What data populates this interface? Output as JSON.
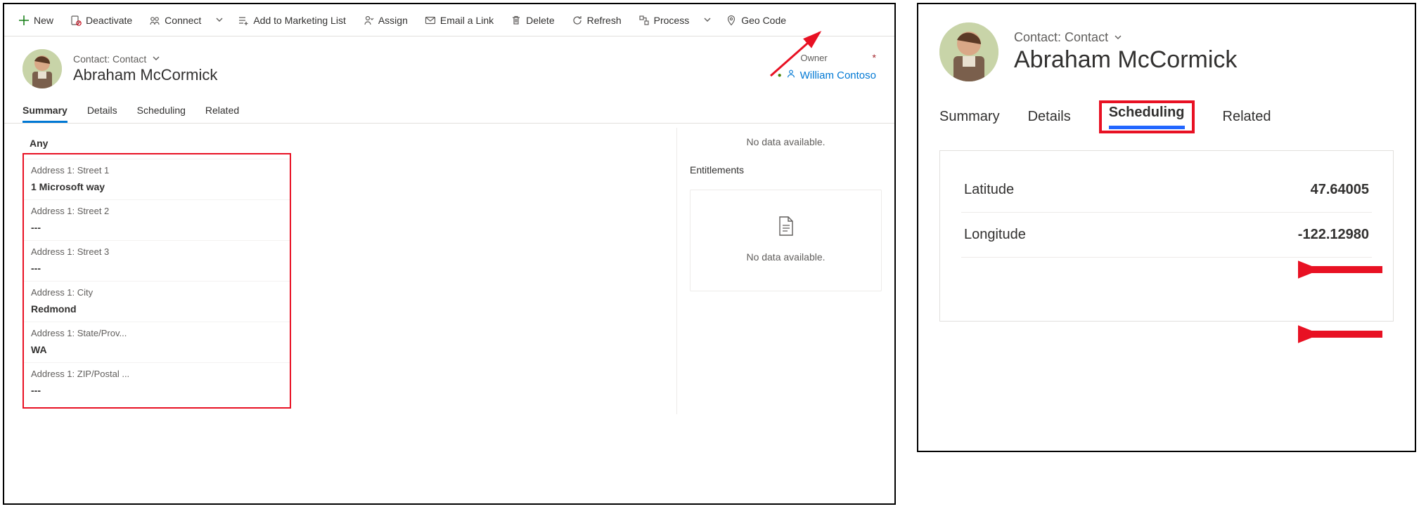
{
  "cmdbar": {
    "new": "New",
    "deactivate": "Deactivate",
    "connect": "Connect",
    "add_marketing": "Add to Marketing List",
    "assign": "Assign",
    "email_link": "Email a Link",
    "delete": "Delete",
    "refresh": "Refresh",
    "process": "Process",
    "geocode": "Geo Code"
  },
  "record": {
    "crumb": "Contact: Contact",
    "name": "Abraham McCormick"
  },
  "owner": {
    "label": "Owner",
    "required": "*",
    "value": "William Contoso"
  },
  "tabs_left": {
    "summary": "Summary",
    "details": "Details",
    "scheduling": "Scheduling",
    "related": "Related"
  },
  "tabs_right": {
    "summary": "Summary",
    "details": "Details",
    "scheduling": "Scheduling",
    "related": "Related"
  },
  "address": {
    "any": "Any",
    "street1_label": "Address 1: Street 1",
    "street1_value": "1 Microsoft way",
    "street2_label": "Address 1: Street 2",
    "street2_value": "---",
    "street3_label": "Address 1: Street 3",
    "street3_value": "---",
    "city_label": "Address 1: City",
    "city_value": "Redmond",
    "state_label": "Address 1: State/Prov...",
    "state_value": "WA",
    "zip_label": "Address 1: ZIP/Postal ...",
    "zip_value": "---"
  },
  "right_col": {
    "no_data_top": "No data available.",
    "entitlements": "Entitlements",
    "no_data_card": "No data available."
  },
  "coords": {
    "lat_label": "Latitude",
    "lat_value": "47.64005",
    "lon_label": "Longitude",
    "lon_value": "-122.12980"
  }
}
